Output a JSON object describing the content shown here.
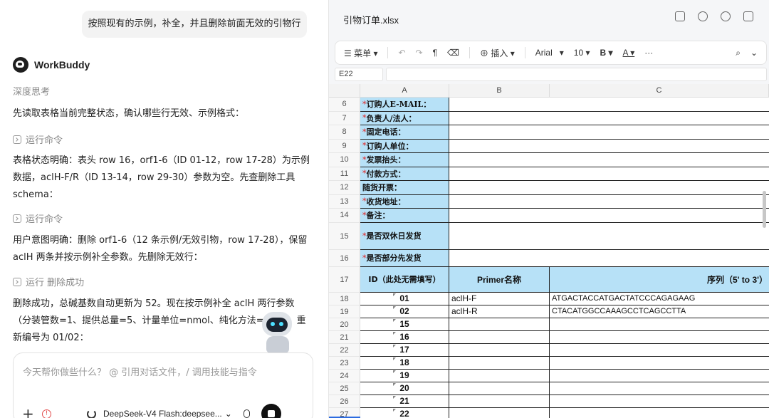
{
  "chat": {
    "user_message": "按照现有的示例，补全，并且删除前面无效的引物行",
    "agent_name": "WorkBuddy",
    "thinking_label": "深度思考",
    "para1": "先读取表格当前完整状态，确认哪些行无效、示例格式：",
    "cmd1": "运行命令",
    "para2": "表格状态明确：表头 row 16，orf1-6（ID 01-12，row 17-28）为示例数据，aclH-F/R（ID 13-14，row 29-30）参数为空。先查删除工具schema：",
    "cmd2": "运行命令",
    "para3": "用户意图明确：删除 orf1-6（12 条示例/无效引物，row 17-28），保留 aclH 两条并按示例补全参数。先删除无效行：",
    "cmd3": "运行 删除成功",
    "para4": "删除成功，总碱基数自动更新为 52。现在按示例补全 aclH 两行参数（分装管数=1、提供总量=5、计量单位=nmol、纯化方法=HAP），重新编号为 01/02：",
    "composer_placeholder": "今天帮你做些什么？ @ 引用对话文件，/ 调用技能与指令",
    "model_label": "DeepSeek-V4 Flash:deepsee...",
    "warn_symbol": "!"
  },
  "sheet": {
    "file_name": "引物订单.xlsx",
    "toolbar": {
      "menu": "菜单",
      "insert": "插入",
      "font": "Arial",
      "font_size": "10",
      "bold": "B",
      "font_color": "A",
      "more": "···"
    },
    "cell_ref": "E22",
    "columns": [
      "A",
      "B",
      "C"
    ],
    "label_rows": [
      {
        "num": "6",
        "star": "*",
        "label": "订购人E-MAIL："
      },
      {
        "num": "7",
        "star": "*",
        "label": "负责人/法人："
      },
      {
        "num": "8",
        "star": "*",
        "label": "固定电话："
      },
      {
        "num": "9",
        "star": "*",
        "label": "订购人单位："
      },
      {
        "num": "10",
        "star": "*",
        "label": "发票抬头："
      },
      {
        "num": "11",
        "star": "*",
        "label": "付款方式："
      },
      {
        "num": "12",
        "star": "",
        "label": "随货开票："
      },
      {
        "num": "13",
        "star": "*",
        "label": "收货地址："
      },
      {
        "num": "14",
        "star": "*",
        "label": "备注："
      },
      {
        "num": "15",
        "star": "*",
        "label": "是否双休日发货"
      },
      {
        "num": "16",
        "star": "*",
        "label": "是否部分先发货"
      }
    ],
    "header_row": {
      "num": "17",
      "a": "ID（此处无需填写）",
      "b": "Primer名称",
      "c": "序列（5' to 3'）"
    },
    "data_rows": [
      {
        "num": "18",
        "id": "01",
        "name": "aclH-F",
        "seq": "ATGACTACCATGACTATCCCAGAGAAG"
      },
      {
        "num": "19",
        "id": "02",
        "name": "aclH-R",
        "seq": "CTACATGGCCAAAGCCTCAGCCTTA"
      },
      {
        "num": "20",
        "id": "15",
        "name": "",
        "seq": ""
      },
      {
        "num": "21",
        "id": "16",
        "name": "",
        "seq": ""
      },
      {
        "num": "22",
        "id": "17",
        "name": "",
        "seq": ""
      },
      {
        "num": "23",
        "id": "18",
        "name": "",
        "seq": ""
      },
      {
        "num": "24",
        "id": "19",
        "name": "",
        "seq": ""
      },
      {
        "num": "25",
        "id": "20",
        "name": "",
        "seq": ""
      },
      {
        "num": "26",
        "id": "21",
        "name": "",
        "seq": ""
      },
      {
        "num": "27",
        "id": "22",
        "name": "",
        "seq": ""
      }
    ]
  }
}
